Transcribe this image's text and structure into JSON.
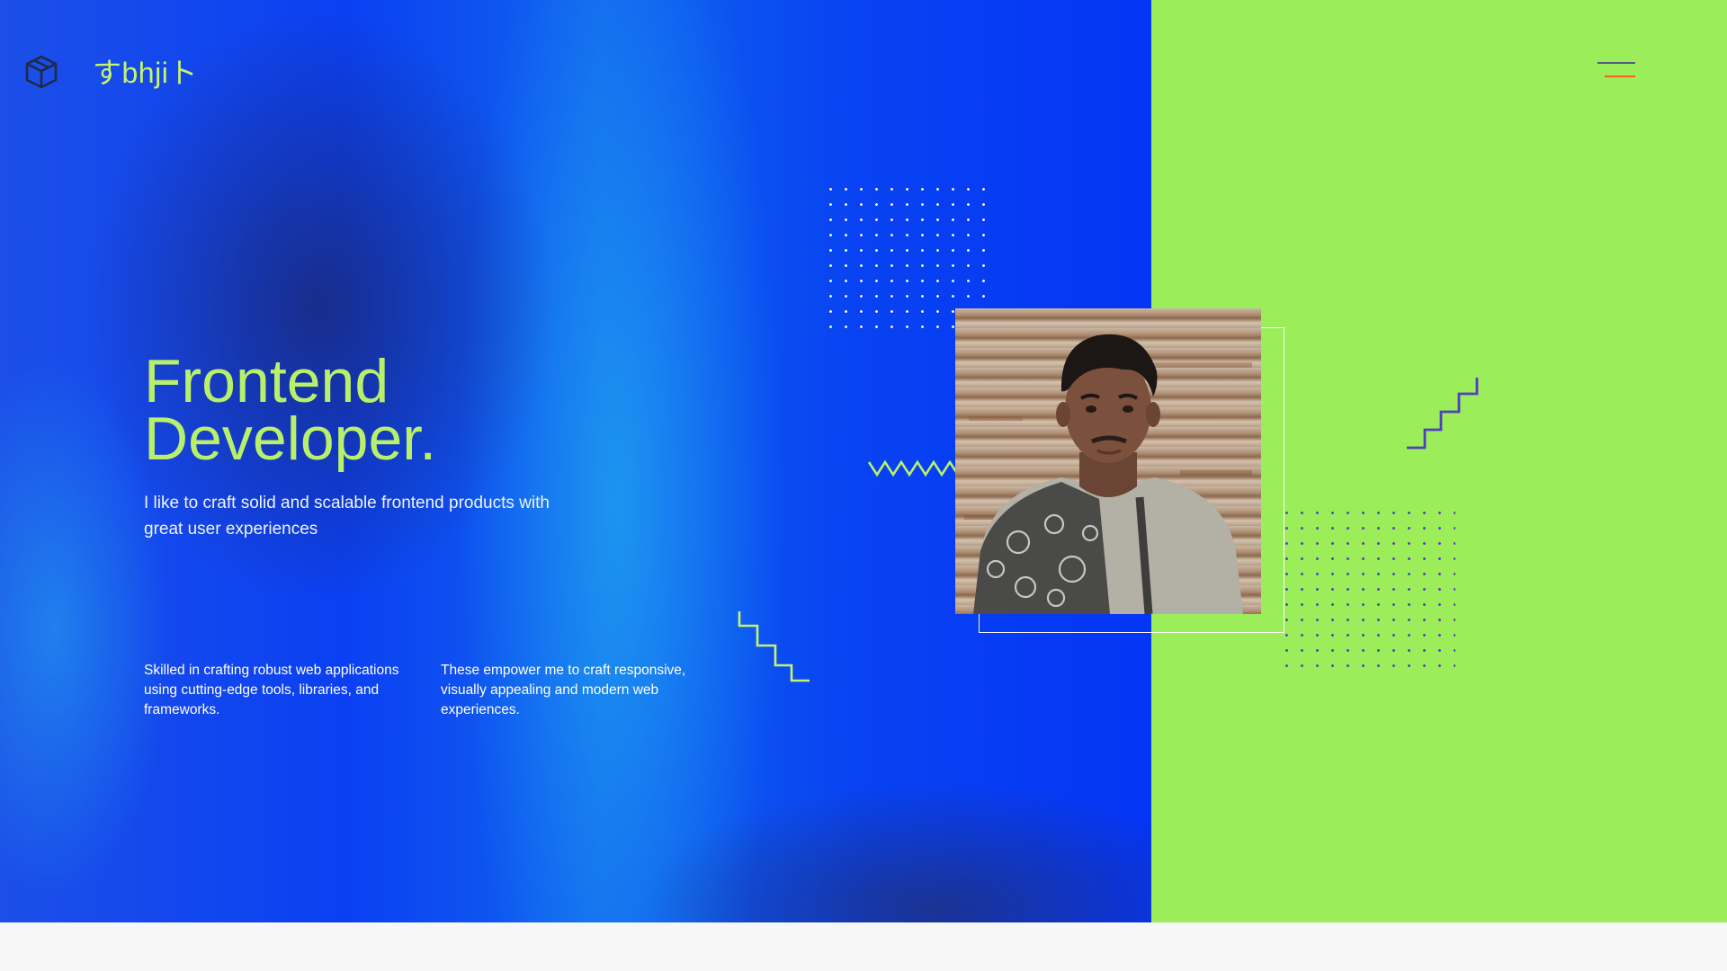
{
  "header": {
    "brand": "すbhjiト",
    "logo_icon": "cube-icon",
    "menu_icon": "hamburger-menu-icon"
  },
  "hero": {
    "title_line1": "Frontend",
    "title_line2": "Developer.",
    "subtitle": "I like to craft solid and scalable frontend products with great user experiences",
    "description_1": "Skilled in crafting robust web applications using cutting-edge tools, libraries, and frameworks.",
    "description_2": "These empower me to craft responsive, visually appealing and modern web experiences."
  },
  "colors": {
    "hero_blue": "#0b40f2",
    "accent_green": "#9bed5a",
    "title_green": "#b8f06c",
    "stairs_purple": "#5140c0",
    "menu_accent_orange": "#ff5a1f",
    "footer_bg": "#f7f7f7"
  }
}
